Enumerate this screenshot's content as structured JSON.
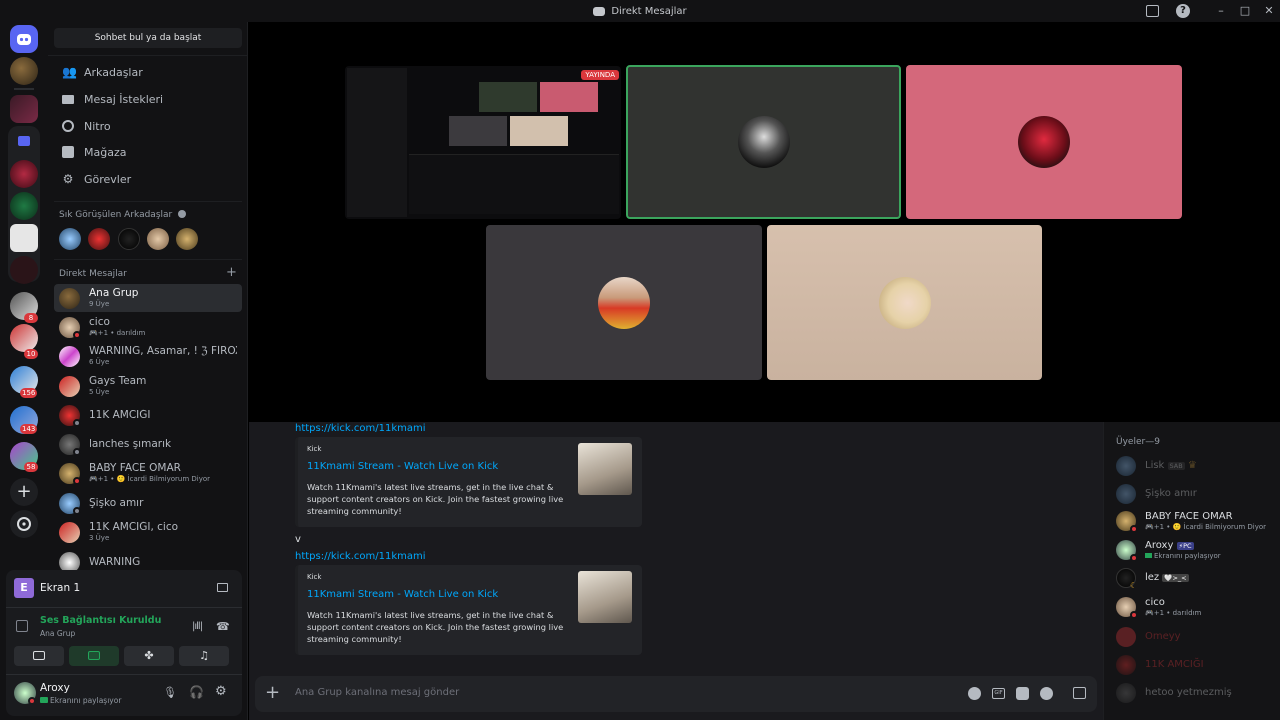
{
  "window": {
    "title": "Direkt Mesajlar"
  },
  "sidebar": {
    "search_placeholder": "Sohbet bul ya da başlat",
    "nav": [
      {
        "label": "Arkadaşlar",
        "icon": "friends-icon"
      },
      {
        "label": "Mesaj İstekleri",
        "icon": "envelope-icon"
      },
      {
        "label": "Nitro",
        "icon": "nitro-icon"
      },
      {
        "label": "Mağaza",
        "icon": "shop-icon"
      },
      {
        "label": "Görevler",
        "icon": "quests-icon"
      }
    ],
    "frequent_title": "Sık Görüşülen Arkadaşlar",
    "dm_title": "Direkt Mesajlar",
    "dms": [
      {
        "name": "Ana Grup",
        "sub": "9 Üye",
        "selected": true
      },
      {
        "name": "cico",
        "sub": "🎮+1 • darıldım"
      },
      {
        "name": "WARNING, Asamar, ! ℨ FİROX...",
        "sub": "6 Üye"
      },
      {
        "name": "Gays Team",
        "sub": "5 Üye"
      },
      {
        "name": "11K AMCIĞI",
        "sub": ""
      },
      {
        "name": "lanches şımarık",
        "sub": ""
      },
      {
        "name": "BABY FACE OMAR",
        "sub": "🎮+1 • 🙂 İcardi Bilmiyorum Diyor"
      },
      {
        "name": "Şişko amır",
        "sub": ""
      },
      {
        "name": "11K AMCIĞI, cico",
        "sub": "3 Üye"
      },
      {
        "name": "WARNING",
        "sub": ""
      }
    ]
  },
  "servers": {
    "badges": [
      "8",
      "10",
      "156",
      "143",
      "58"
    ]
  },
  "voice_panel": {
    "stream_title": "Ekran 1",
    "stream_initial": "E",
    "status": "Ses Bağlantısı Kuruldu",
    "channel": "Ana Grup"
  },
  "user": {
    "name": "Aroxy",
    "status": "Ekranını paylaşıyor"
  },
  "stage": {
    "live_badge": "YAYINDA"
  },
  "chat": {
    "messages": [
      {
        "link": "https://kick.com/11kmami",
        "embed": {
          "provider": "Kick",
          "title": "11Kmami Stream - Watch Live on Kick",
          "description": "Watch 11Kmami's latest live streams, get in the live chat & support content creators on Kick. Join the fastest growing live streaming community!"
        }
      },
      {
        "pre_text": "v",
        "link": "https://kick.com/11kmami",
        "embed": {
          "provider": "Kick",
          "title": "11Kmami Stream - Watch Live on Kick",
          "description": "Watch 11Kmami's latest live streams, get in the live chat & support content creators on Kick. Join the fastest growing live streaming community!"
        }
      }
    ],
    "composer_placeholder": "Ana Grup kanalına mesaj gönder"
  },
  "members": {
    "title": "Üyeler—9",
    "list": [
      {
        "name": "Lisk",
        "tag": "SAB",
        "sub": "",
        "offline": true
      },
      {
        "name": "Şişko amır",
        "tag": "",
        "sub": "",
        "offline": true
      },
      {
        "name": "BABY FACE OMAR",
        "tag": "",
        "sub": "🎮+1 • 🙂 İcardi Bilmiyorum Diyor",
        "offline": false
      },
      {
        "name": "Aroxy",
        "tag": "⚡PC",
        "sub": "Ekranını paylaşıyor",
        "offline": false
      },
      {
        "name": "lez",
        "tag": "🤍>_<",
        "sub": "",
        "offline": false
      },
      {
        "name": "cico",
        "tag": "",
        "sub": "🎮+1 • darıldım",
        "offline": false
      },
      {
        "name": "Omeyy",
        "tag": "",
        "sub": "",
        "offline": true
      },
      {
        "name": "11K AMCIĞI",
        "tag": "",
        "sub": "",
        "offline": true
      },
      {
        "name": "hetoo yetmezmiş",
        "tag": "",
        "sub": "",
        "offline": true
      }
    ]
  },
  "colors": {
    "blurple": "#5865f2",
    "link": "#00a8fc",
    "connected": "#23a55a",
    "danger": "#da373c"
  }
}
